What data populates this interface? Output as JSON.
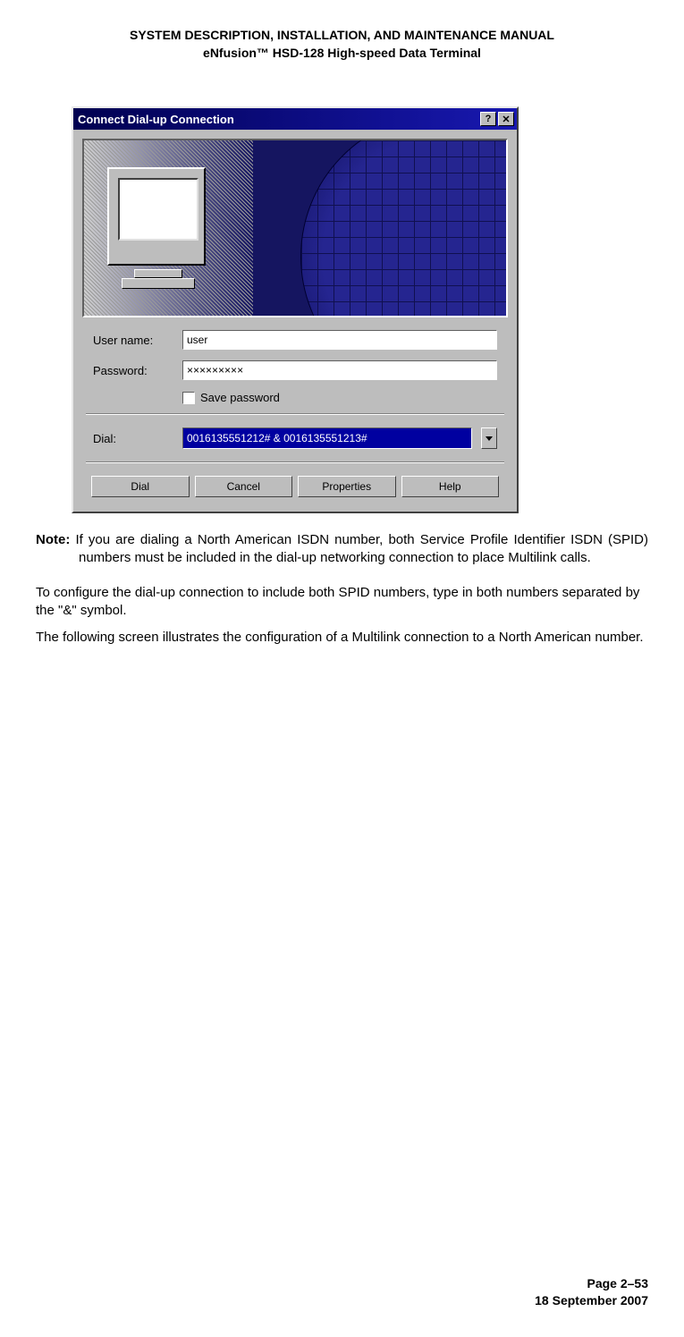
{
  "header": {
    "line1": "SYSTEM DESCRIPTION, INSTALLATION, AND MAINTENANCE MANUAL",
    "line2": "eNfusion™ HSD-128 High-speed Data Terminal"
  },
  "dialog": {
    "title": "Connect Dial-up Connection",
    "help_btn": "?",
    "close_btn": "✕",
    "username_label": "User name:",
    "username_value": "user",
    "password_label": "Password:",
    "password_value": "×××××××××",
    "save_password_label": "Save password",
    "dial_label": "Dial:",
    "dial_value": "0016135551212# & 0016135551213#",
    "buttons": {
      "dial": "Dial",
      "cancel": "Cancel",
      "properties": "Properties",
      "help": "Help"
    }
  },
  "body": {
    "note_label": "Note:",
    "note_text": "If you are dialing a North American ISDN number, both Service Profile Identifier ISDN (SPID) numbers must be included in the dial-up networking connection to place Multilink calls.",
    "para1": "To configure the dial-up connection to include both SPID numbers, type in both numbers separated by the \"&\" symbol.",
    "para2": "The following screen illustrates the configuration of a Multilink connection to a North American number."
  },
  "footer": {
    "page": "Page 2–53",
    "date": "18 September 2007"
  }
}
